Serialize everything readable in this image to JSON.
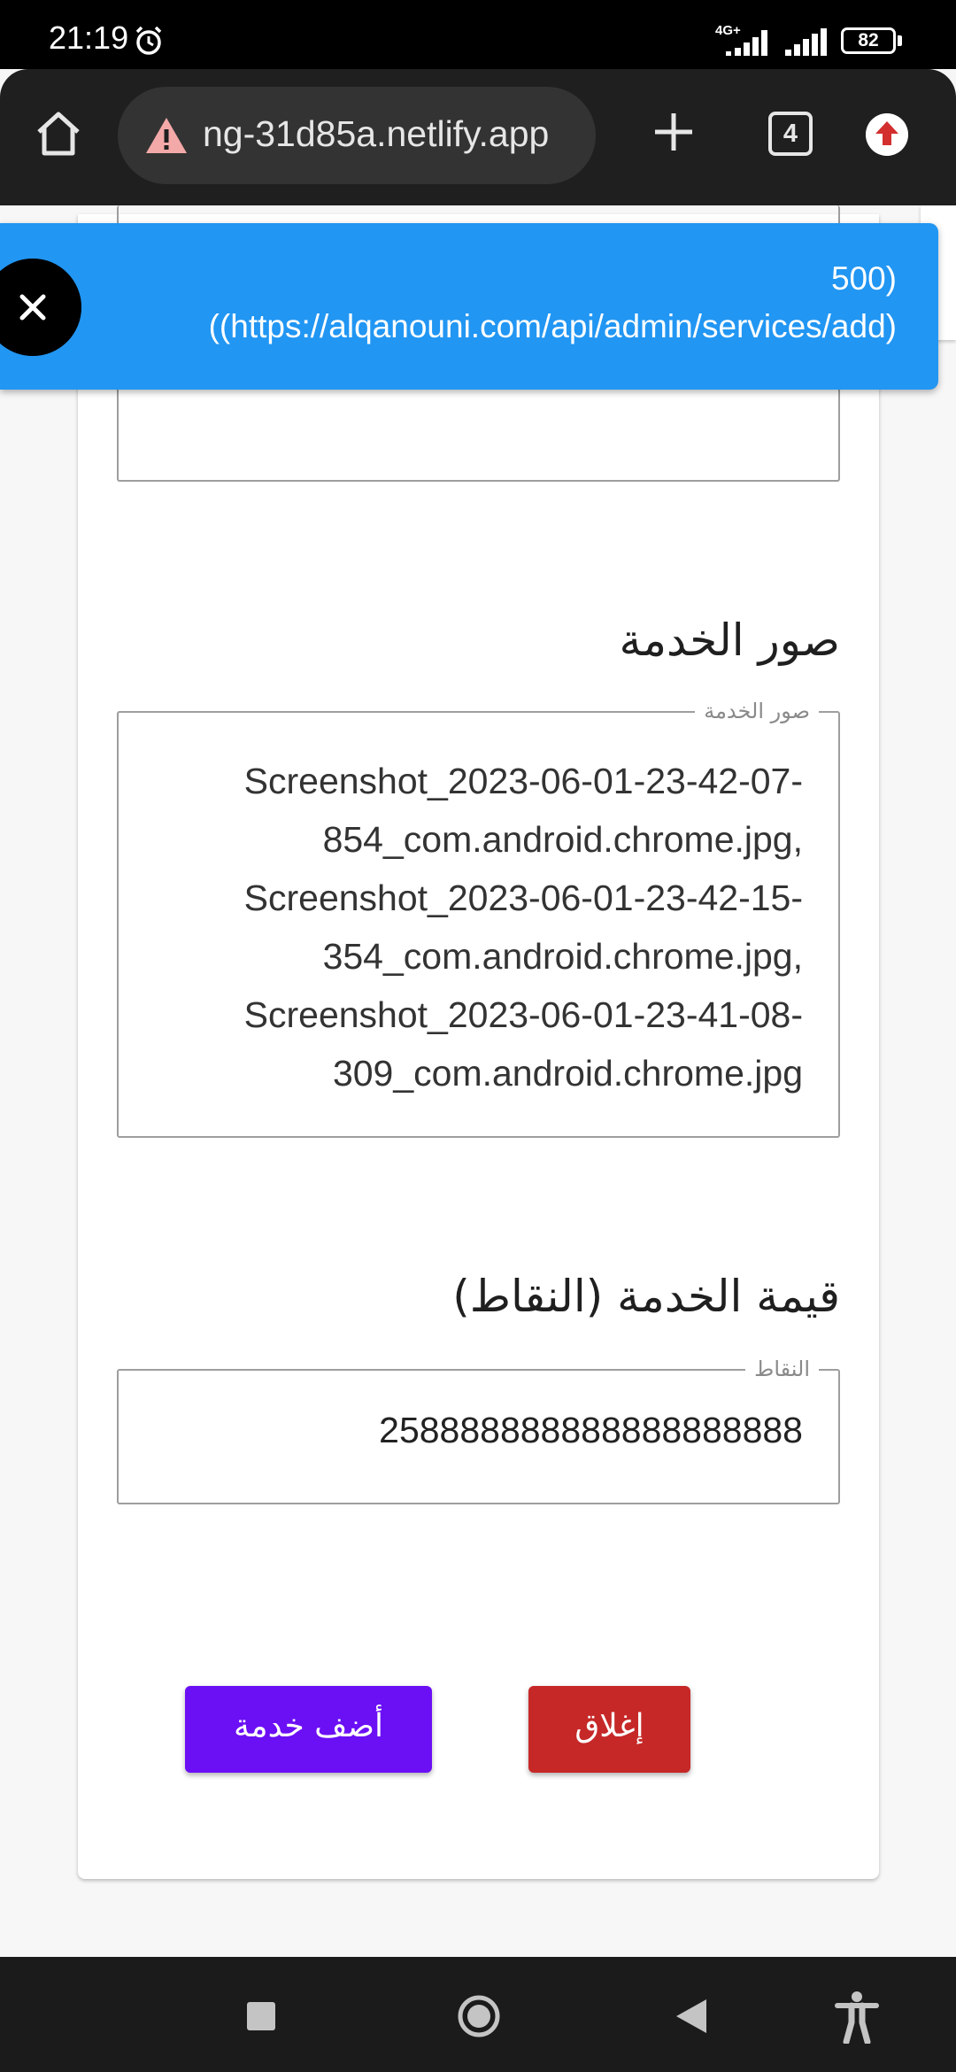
{
  "status_bar": {
    "time": "21:19",
    "network": "4G+",
    "battery": "82"
  },
  "browser": {
    "url": "ng-31d85a.netlify.app",
    "tab_count": "4"
  },
  "toast": {
    "line1": "500)",
    "line2": "((https://alqanouni.com/api/admin/services/add)"
  },
  "form": {
    "images_title": "صور الخدمة",
    "images_legend": "صور الخدمة",
    "images_value": "Screenshot_2023-06-01-23-42-07-854_com.android.chrome.jpg, Screenshot_2023-06-01-23-42-15-354_com.android.chrome.jpg, Screenshot_2023-06-01-23-41-08-309_com.android.chrome.jpg",
    "points_title": "قيمة الخدمة (النقاط)",
    "points_legend": "النقاط",
    "points_value": "258888888888888888888"
  },
  "buttons": {
    "add": "أضف خدمة",
    "close": "إغلاق"
  },
  "colors": {
    "toast": "#2196f3",
    "add_button": "#6b0ff5",
    "close_button": "#c62828"
  }
}
